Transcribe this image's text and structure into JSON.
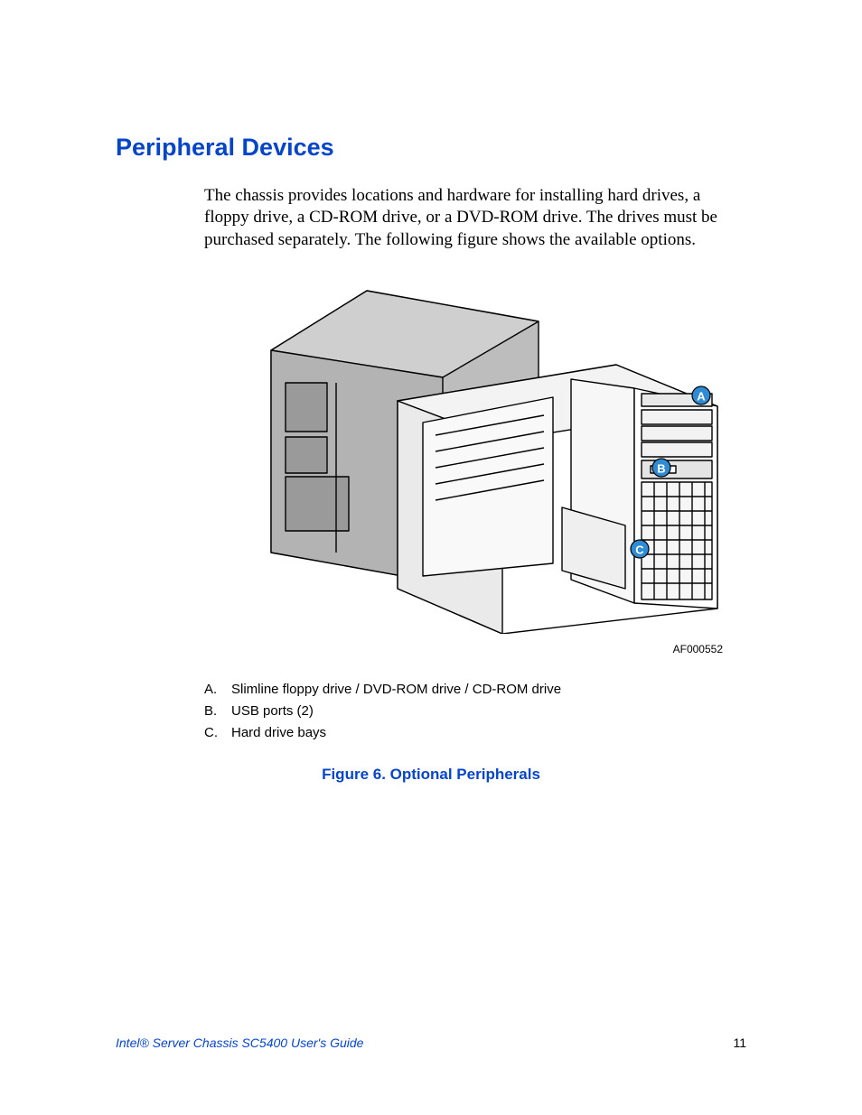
{
  "section": {
    "title": "Peripheral Devices",
    "paragraph": "The chassis provides locations and hardware for installing hard drives, a floppy drive, a CD-ROM drive, or a DVD-ROM drive. The drives must be purchased separately. The following figure shows the available options."
  },
  "figure": {
    "code": "AF000552",
    "callouts": {
      "A": {
        "letter": "A.",
        "text": "Slimline floppy drive / DVD-ROM drive / CD-ROM drive"
      },
      "B": {
        "letter": "B.",
        "text": "USB ports (2)"
      },
      "C": {
        "letter": "C.",
        "text": "Hard drive bays"
      }
    },
    "caption": "Figure 6. Optional Peripherals",
    "labels": {
      "A": "A",
      "B": "B",
      "C": "C"
    }
  },
  "footer": {
    "doc_title": "Intel® Server Chassis SC5400 User's Guide",
    "page_number": "11"
  },
  "colors": {
    "accent": "#0645c8",
    "callout_fill": "#2f8bd3"
  }
}
